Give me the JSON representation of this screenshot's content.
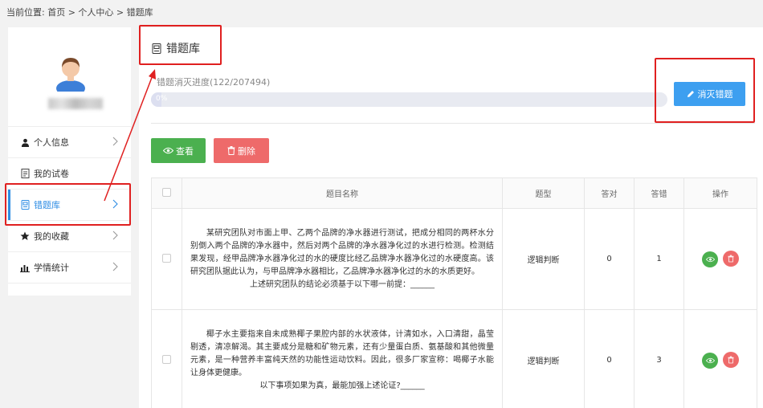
{
  "breadcrumb": "当前位置: 首页 > 个人中心 > 错题库",
  "sidebar": {
    "items": [
      {
        "label": "个人信息",
        "icon": "user-icon"
      },
      {
        "label": "我的试卷",
        "icon": "document-icon"
      },
      {
        "label": "错题库",
        "icon": "notebook-icon",
        "active": true
      },
      {
        "label": "我的收藏",
        "icon": "star-icon"
      },
      {
        "label": "学情统计",
        "icon": "bar-chart-icon"
      }
    ]
  },
  "panel": {
    "title": "错题库",
    "progress_label": "错题消灭进度(122/207494)",
    "progress_fraction": 0.000588,
    "progress_text": "0%",
    "clear_button": "消灭错题"
  },
  "toolbar": {
    "view_label": "查看",
    "delete_label": "删除"
  },
  "table": {
    "headers": [
      "题目名称",
      "题型",
      "答对",
      "答错",
      "操作"
    ],
    "rows": [
      {
        "paragraph": "某研究团队对市面上甲、乙两个品牌的净水器进行测试，把成分相同的两杯水分别倒入两个品牌的净水器中，然后对两个品牌的净水器净化过的水进行检测。检测结果发现，经甲品牌净水器净化过的水的硬度比经乙品牌净水器净化过的水硬度高。该研究团队据此认为，与甲品牌净水器相比，乙品牌净水器净化过的水的水质更好。",
        "tail": "上述研究团队的结论必须基于以下哪一前提：______",
        "type": "逻辑判断",
        "correct": "0",
        "wrong": "1"
      },
      {
        "paragraph": "椰子水主要指来自未成熟椰子果腔内部的水状液体，计清如水，入口清甜，晶莹剔透，清凉解渴。其主要成分是糖和矿物元素，还有少量蛋白质、氨基酸和其他微量元素，是一种营养丰富纯天然的功能性运动饮料。因此，很多厂家宣称：喝椰子水能让身体更健康。",
        "tail": "以下事项如果为真，最能加强上述论证?______",
        "type": "逻辑判断",
        "correct": "0",
        "wrong": "3"
      }
    ]
  },
  "colors": {
    "accent": "#3d9ff0",
    "green": "#4bb04f",
    "red": "#ee6a6a",
    "annotation": "#e02020"
  }
}
